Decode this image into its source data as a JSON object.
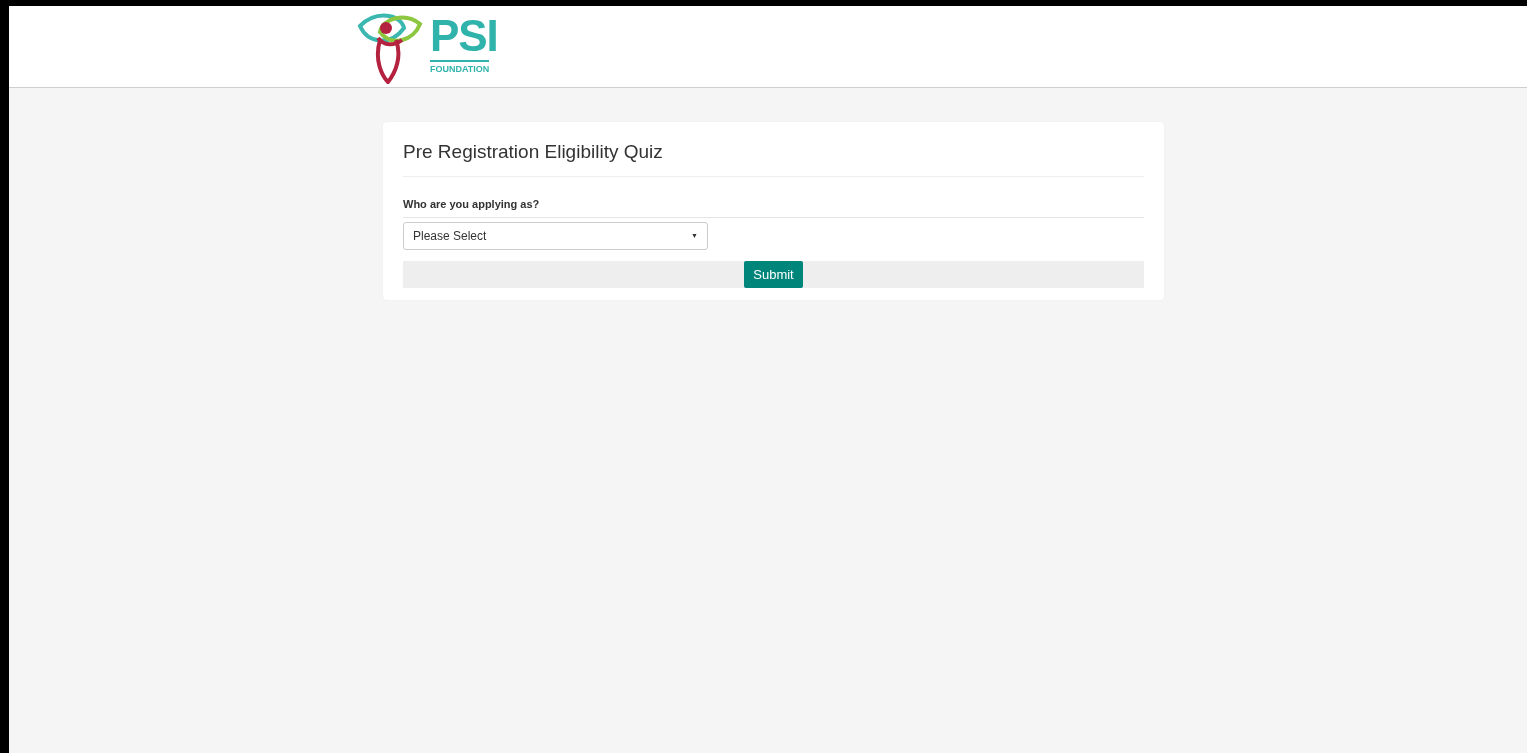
{
  "header": {
    "logo": {
      "name": "PSI",
      "subtitle": "FOUNDATION"
    }
  },
  "form": {
    "title": "Pre Registration Eligibility Quiz",
    "question": "Who are you applying as?",
    "select": {
      "value": "Please Select",
      "caret": "▼"
    },
    "submit": "Submit"
  }
}
